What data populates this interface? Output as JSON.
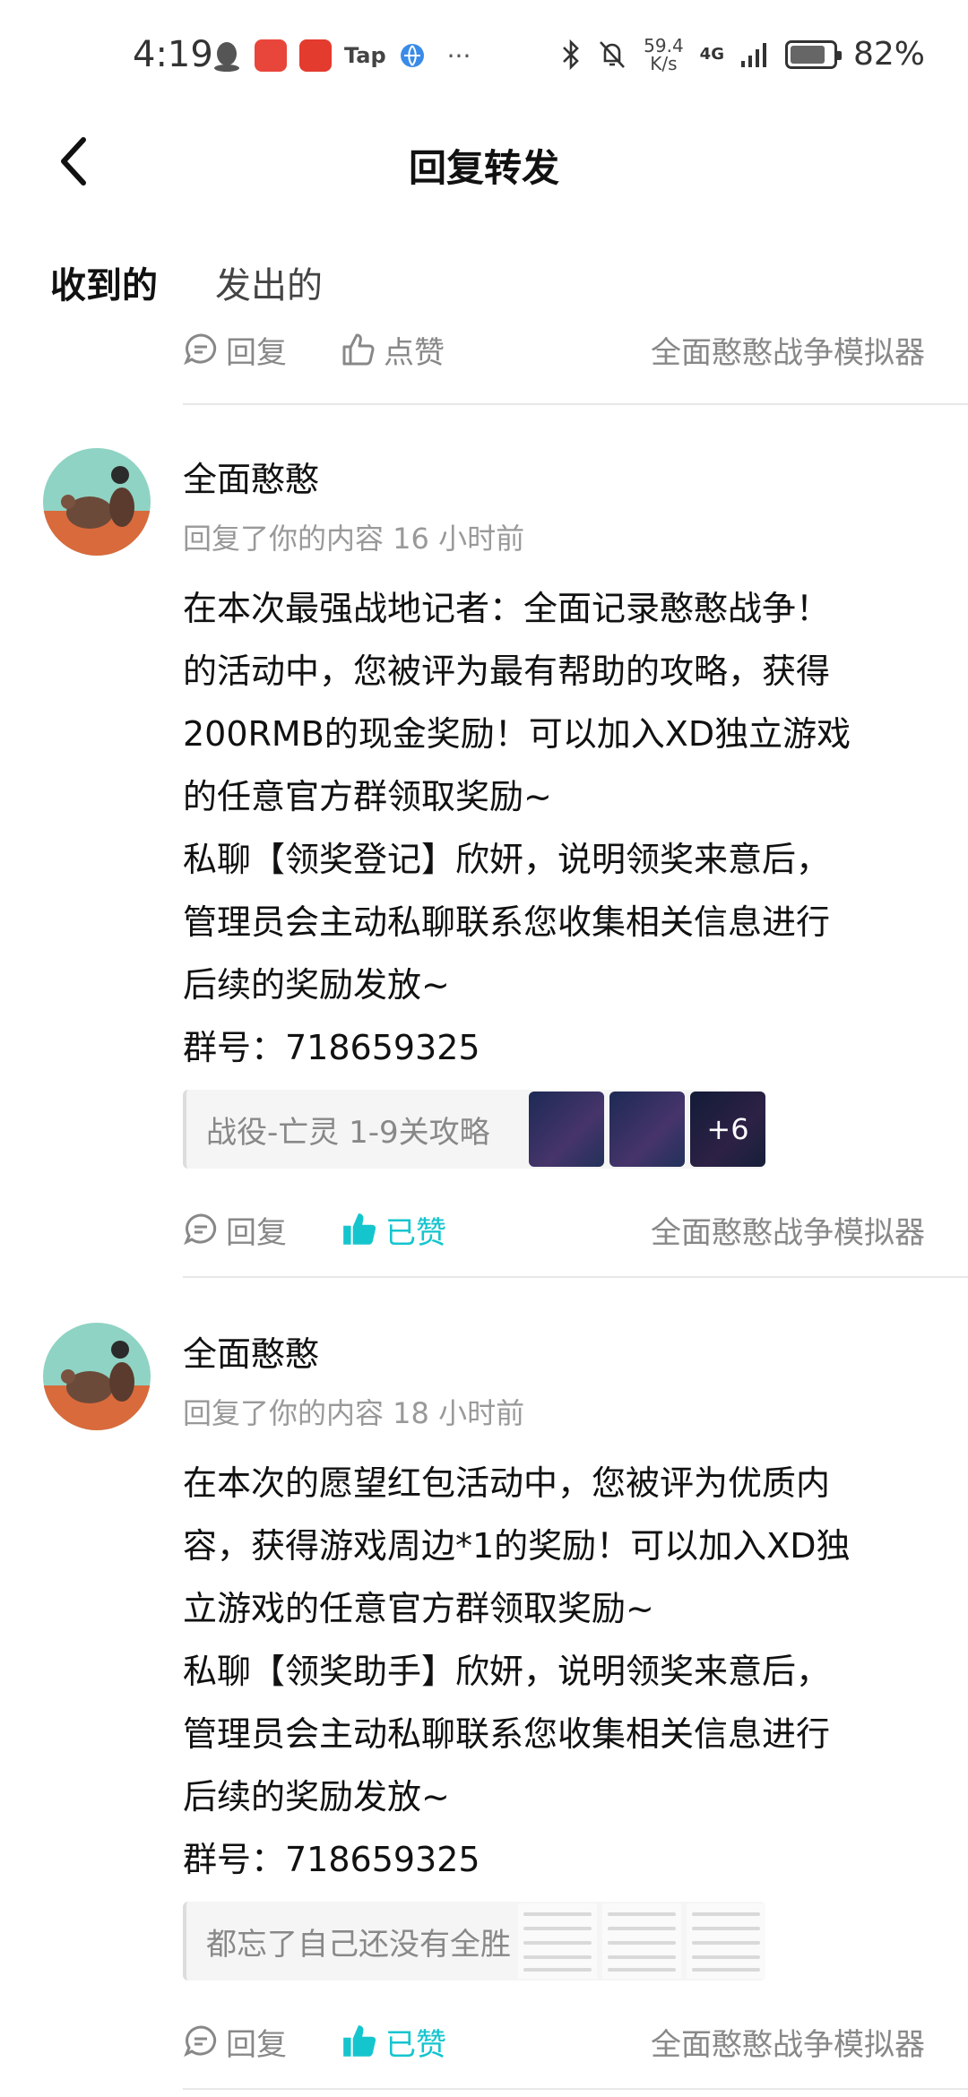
{
  "status_bar": {
    "time": "4:19",
    "app_tap": "Tap",
    "more": "···",
    "net_speed_value": "59.4",
    "net_speed_unit": "K/s",
    "signal": "4G",
    "battery": "82%",
    "battery_level": 0.82
  },
  "header": {
    "title": "回复转发"
  },
  "tabs": {
    "received": "收到的",
    "sent": "发出的"
  },
  "top_action_row": {
    "reply": "回复",
    "like": "点赞",
    "source": "全面憨憨战争模拟器"
  },
  "items": [
    {
      "user": "全面憨憨",
      "meta": "回复了你的内容 16 小时前",
      "lines": [
        "在本次最强战地记者：全面记录憨憨战争！",
        "的活动中，您被评为最有帮助的攻略，获得",
        "200RMB的现金奖励！可以加入XD独立游戏",
        "的任意官方群领取奖励~",
        "私聊【领奖登记】欣妍，说明领奖来意后，",
        "管理员会主动私聊联系您收集相关信息进行",
        "后续的奖励发放~",
        "群号：718659325"
      ],
      "quote": "战役-亡灵 1-9关攻略",
      "more_count": "+6",
      "reply": "回复",
      "like": "已赞",
      "source": "全面憨憨战争模拟器"
    },
    {
      "user": "全面憨憨",
      "meta": "回复了你的内容 18 小时前",
      "lines": [
        "在本次的愿望红包活动中，您被评为优质内",
        "容，获得游戏周边*1的奖励！可以加入XD独",
        "立游戏的任意官方群领取奖励~",
        "私聊【领奖助手】欣妍，说明领奖来意后，",
        "管理员会主动私聊联系您收集相关信息进行",
        "后续的奖励发放~",
        "群号：718659325"
      ],
      "quote": "都忘了自己还没有全胜",
      "reply": "回复",
      "like": "已赞",
      "source": "全面憨憨战争模拟器"
    }
  ],
  "colors": {
    "accent": "#15c5ce",
    "muted": "#888888",
    "divider": "#e8e8e8"
  }
}
